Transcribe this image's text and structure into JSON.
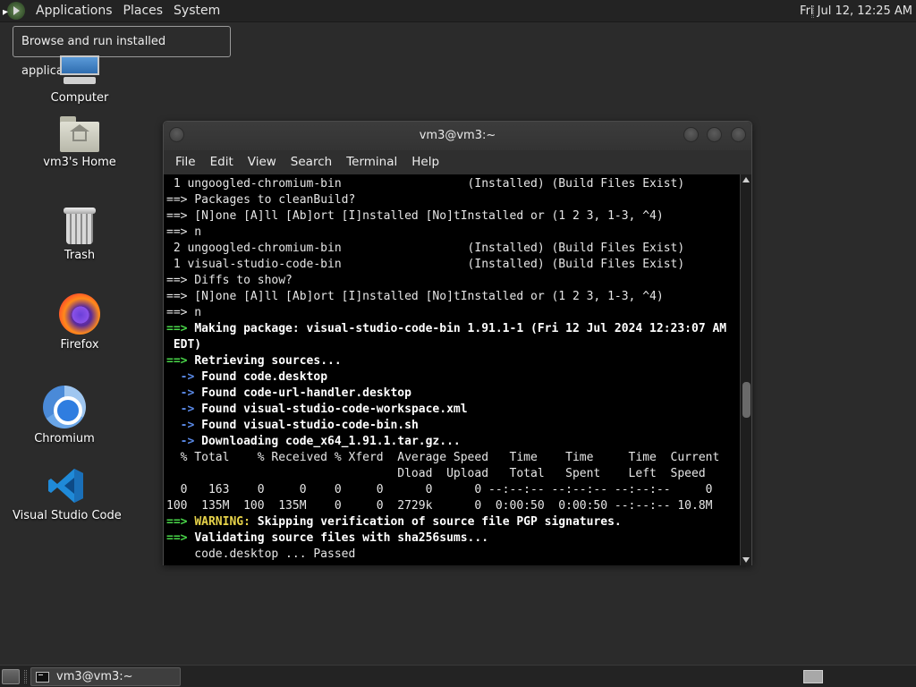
{
  "top_panel": {
    "menus": [
      "Applications",
      "Places",
      "System"
    ],
    "clock": "Fri Jul 12, 12:25 AM"
  },
  "tooltip": {
    "text": "Browse and run installed applications"
  },
  "desktop_icons": [
    {
      "label": "Computer"
    },
    {
      "label": "vm3's Home"
    },
    {
      "label": "Trash"
    },
    {
      "label": "Firefox"
    },
    {
      "label": "Chromium"
    },
    {
      "label": "Visual Studio Code"
    }
  ],
  "terminal": {
    "title": "vm3@vm3:~",
    "menu": [
      "File",
      "Edit",
      "View",
      "Search",
      "Terminal",
      "Help"
    ],
    "lines": [
      [
        {
          "t": " 1 ungoogled-chromium-bin                  (Installed) (Build Files Exist)",
          "c": ""
        }
      ],
      [
        {
          "t": "==> ",
          "c": ""
        },
        {
          "t": "Packages to cleanBuild?",
          "c": ""
        }
      ],
      [
        {
          "t": "==> [N]one [A]ll [Ab]ort [I]nstalled [No]tInstalled or (1 2 3, 1-3, ^4)",
          "c": ""
        }
      ],
      [
        {
          "t": "==> n",
          "c": ""
        }
      ],
      [
        {
          "t": " 2 ungoogled-chromium-bin                  (Installed) (Build Files Exist)",
          "c": ""
        }
      ],
      [
        {
          "t": " 1 visual-studio-code-bin                  (Installed) (Build Files Exist)",
          "c": ""
        }
      ],
      [
        {
          "t": "==> Diffs to show?",
          "c": ""
        }
      ],
      [
        {
          "t": "==> [N]one [A]ll [Ab]ort [I]nstalled [No]tInstalled or (1 2 3, 1-3, ^4)",
          "c": ""
        }
      ],
      [
        {
          "t": "==> n",
          "c": ""
        }
      ],
      [
        {
          "t": "==> ",
          "c": "g"
        },
        {
          "t": "Making package: visual-studio-code-bin 1.91.1-1 (Fri 12 Jul 2024 12:23:07 AM",
          "c": "b"
        }
      ],
      [
        {
          "t": " EDT)",
          "c": "b"
        }
      ],
      [
        {
          "t": "==> ",
          "c": "g"
        },
        {
          "t": "Retrieving sources...",
          "c": "b"
        }
      ],
      [
        {
          "t": "  -> ",
          "c": "bl"
        },
        {
          "t": "Found code.desktop",
          "c": "b"
        }
      ],
      [
        {
          "t": "  -> ",
          "c": "bl"
        },
        {
          "t": "Found code-url-handler.desktop",
          "c": "b"
        }
      ],
      [
        {
          "t": "  -> ",
          "c": "bl"
        },
        {
          "t": "Found visual-studio-code-workspace.xml",
          "c": "b"
        }
      ],
      [
        {
          "t": "  -> ",
          "c": "bl"
        },
        {
          "t": "Found visual-studio-code-bin.sh",
          "c": "b"
        }
      ],
      [
        {
          "t": "  -> ",
          "c": "bl"
        },
        {
          "t": "Downloading code_x64_1.91.1.tar.gz...",
          "c": "b"
        }
      ],
      [
        {
          "t": "  % Total    % Received % Xferd  Average Speed   Time    Time     Time  Current",
          "c": ""
        }
      ],
      [
        {
          "t": "                                 Dload  Upload   Total   Spent    Left  Speed",
          "c": ""
        }
      ],
      [
        {
          "t": "  0   163    0     0    0     0      0      0 --:--:-- --:--:-- --:--:--     0",
          "c": ""
        }
      ],
      [
        {
          "t": "100  135M  100  135M    0     0  2729k      0  0:00:50  0:00:50 --:--:-- 10.8M",
          "c": ""
        }
      ],
      [
        {
          "t": "==> ",
          "c": "g"
        },
        {
          "t": "WARNING: ",
          "c": "y"
        },
        {
          "t": "Skipping verification of source file PGP signatures.",
          "c": "b"
        }
      ],
      [
        {
          "t": "==> ",
          "c": "g"
        },
        {
          "t": "Validating source files with sha256sums...",
          "c": "b"
        }
      ],
      [
        {
          "t": "    code.desktop ... Passed",
          "c": ""
        }
      ]
    ]
  },
  "bottom_panel": {
    "task_label": "vm3@vm3:~"
  }
}
